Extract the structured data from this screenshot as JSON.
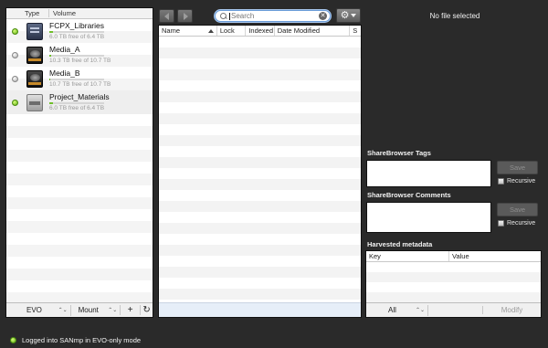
{
  "volumes_panel": {
    "headers": {
      "type": "Type",
      "volume": "Volume"
    },
    "volumes": [
      {
        "name": "FCPX_Libraries",
        "free_text": "6.0 TB free of 6.4 TB",
        "status": "connected",
        "icon": "raid-drive-icon",
        "used_fraction": 0.06
      },
      {
        "name": "Media_A",
        "free_text": "10.3 TB free of 10.7 TB",
        "status": "disconnected",
        "icon": "external-drive-icon",
        "used_fraction": 0.04
      },
      {
        "name": "Media_B",
        "free_text": "10.7 TB free of 10.7 TB",
        "status": "disconnected",
        "icon": "external-drive-icon",
        "used_fraction": 0.01
      },
      {
        "name": "Project_Materials",
        "free_text": "6.0 TB free of 6.4 TB",
        "status": "connected",
        "icon": "hard-disk-icon",
        "used_fraction": 0.06
      }
    ],
    "toolbar": {
      "mode": "EVO",
      "mount": "Mount",
      "add": "+",
      "refresh_icon": "refresh-icon"
    }
  },
  "file_browser": {
    "search": {
      "placeholder": "Search",
      "value": ""
    },
    "columns": [
      "Name",
      "Lock",
      "Indexed",
      "Date Modified",
      "S"
    ]
  },
  "inspector": {
    "no_file": "No file selected",
    "tags": {
      "label": "ShareBrowser Tags",
      "save": "Save",
      "recursive": "Recursive"
    },
    "comments": {
      "label": "ShareBrowser Comments",
      "save": "Save",
      "recursive": "Recursive"
    },
    "metadata": {
      "label": "Harvested metadata",
      "columns": {
        "key": "Key",
        "value": "Value"
      },
      "filter": "All",
      "modify": "Modify"
    }
  },
  "status_bar": {
    "text": "Logged into SANmp in EVO-only mode"
  },
  "colors": {
    "connected": "#5fae12",
    "disconnected": "#a8a8a8",
    "accent": "#6a9bd6"
  }
}
